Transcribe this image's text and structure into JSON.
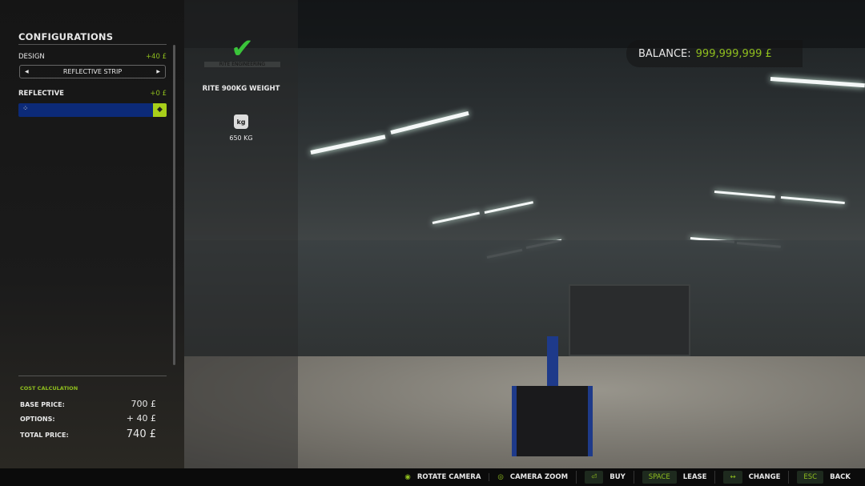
{
  "configurations": {
    "title": "CONFIGURATIONS",
    "design": {
      "label": "DESIGN",
      "price": "+40 £",
      "value": "REFLECTIVE STRIP"
    },
    "reflective": {
      "label": "REFLECTIVE",
      "price": "+0 £",
      "color": "#0c2a78"
    }
  },
  "cost": {
    "title": "COST CALCULATION",
    "base_label": "BASE PRICE:",
    "base_value": "700 £",
    "options_label": "OPTIONS:",
    "options_value": "+ 40 £",
    "total_label": "TOTAL PRICE:",
    "total_value": "740 £"
  },
  "item": {
    "brand": "RITE ENGINEERING",
    "brand_tagline": "DESIGN, FABRICATE, INNOVATE",
    "name": "RITE 900KG WEIGHT",
    "weight_icon": "kg",
    "weight": "650 KG"
  },
  "balance": {
    "label": "BALANCE:",
    "value": "999,999,999 £"
  },
  "footer": [
    {
      "key": "",
      "label": "ROTATE CAMERA",
      "icon": "mouse-icon"
    },
    {
      "key": "",
      "label": "CAMERA ZOOM",
      "icon": "mouse-wheel-icon"
    },
    {
      "key": "⏎",
      "label": "BUY"
    },
    {
      "key": "SPACE",
      "label": "LEASE"
    },
    {
      "key": "↔",
      "label": "CHANGE"
    },
    {
      "key": "ESC",
      "label": "BACK"
    }
  ],
  "colors": {
    "accent": "#8fbe1e"
  }
}
